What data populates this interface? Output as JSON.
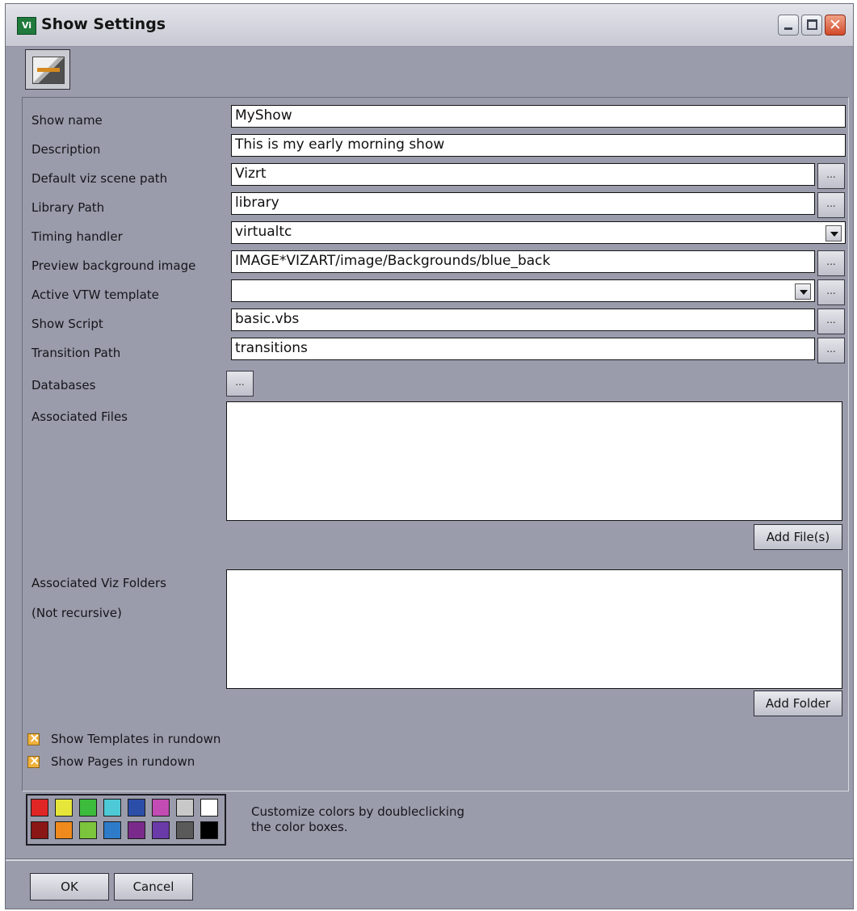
{
  "window": {
    "title": "Show Settings",
    "app_icon_text": "Vi",
    "close_glyph": "✕"
  },
  "form": {
    "show_name": {
      "label": "Show name",
      "value": "MyShow"
    },
    "description": {
      "label": "Description",
      "value": "This is my early morning show"
    },
    "default_viz_scene_path": {
      "label": "Default viz scene path",
      "value": "Vizrt"
    },
    "library_path": {
      "label": "Library Path",
      "value": "library"
    },
    "timing_handler": {
      "label": "Timing handler",
      "value": "virtualtc"
    },
    "preview_background_image": {
      "label": "Preview background image",
      "value": "IMAGE*VIZART/image/Backgrounds/blue_back"
    },
    "active_vtw_template": {
      "label": "Active VTW template",
      "value": ""
    },
    "show_script": {
      "label": "Show Script",
      "value": "basic.vbs"
    },
    "transition_path": {
      "label": "Transition Path",
      "value": "transitions"
    },
    "databases": {
      "label": "Databases"
    },
    "browse_label": "...",
    "associated_files": {
      "label": "Associated Files",
      "button": "Add File(s)"
    },
    "associated_viz_folders": {
      "label": "Associated Viz Folders",
      "sublabel": "(Not recursive)",
      "button": "Add Folder"
    },
    "show_templates_in_rundown": {
      "label": "Show Templates in rundown",
      "checked": true
    },
    "show_pages_in_rundown": {
      "label": "Show Pages in rundown",
      "checked": true
    }
  },
  "palette": {
    "hint": "Customize colors by doubleclicking\nthe color boxes.",
    "top_row": [
      "#e02525",
      "#e6e63a",
      "#3cbb3c",
      "#4ec9d6",
      "#2b4ea8",
      "#c24cb4",
      "#c8c8c8",
      "#ffffff"
    ],
    "bottom_row": [
      "#8a1616",
      "#f08a1c",
      "#7cc43c",
      "#2e7cc9",
      "#7a2a8a",
      "#6a3aa8",
      "#5a5a5a",
      "#000000"
    ]
  },
  "footer": {
    "ok_label": "OK",
    "cancel_label": "Cancel"
  }
}
